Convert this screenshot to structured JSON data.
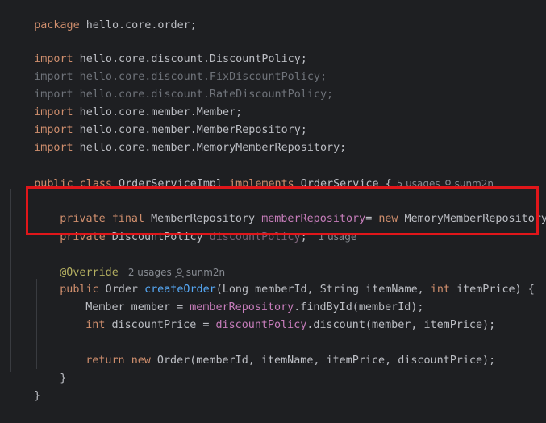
{
  "editor": {
    "language": "java",
    "colors": {
      "background": "#1e1f22",
      "keyword": "#cf8e6d",
      "text": "#bcbec4",
      "field": "#c77dbb",
      "method": "#56a8f5",
      "annotation": "#b3ae60",
      "unused": "#6f737a",
      "highlight_box": "#e0161a"
    },
    "package_line": {
      "kw": "package",
      "name": " hello.core.order;"
    },
    "imports": [
      {
        "kw": "import",
        "path": " hello.core.discount.DiscountPolicy;",
        "unused": false
      },
      {
        "kw": "import",
        "path": " hello.core.discount.FixDiscountPolicy;",
        "unused": true
      },
      {
        "kw": "import",
        "path": " hello.core.discount.RateDiscountPolicy;",
        "unused": true
      },
      {
        "kw": "import",
        "path": " hello.core.member.Member;",
        "unused": false
      },
      {
        "kw": "import",
        "path": " hello.core.member.MemberRepository;",
        "unused": false
      },
      {
        "kw": "import",
        "path": " hello.core.member.MemoryMemberRepository;",
        "unused": false
      }
    ],
    "class_decl": {
      "kw1": "public class",
      "name": " OrderServiceImpl ",
      "kw2": "implements",
      "iface": " OrderService {",
      "usages": "5 usages",
      "author": "sunm2n"
    },
    "field1": {
      "mods": "private final",
      "type": " MemberRepository ",
      "name": "memberRepository",
      "eq": "= ",
      "kw_new": "new",
      "init": " MemoryMemberRepository();"
    },
    "field2": {
      "mods": "private",
      "type": " DiscountPolicy ",
      "name": "discountPolicy",
      "semi": ";",
      "usages": "1 usage"
    },
    "override": {
      "ann": "@Override",
      "usages": "2 usages",
      "author": "sunm2n"
    },
    "method_sig": {
      "kw": "public",
      "ret": " Order ",
      "name": "createOrder",
      "p1": "(Long memberId, String itemName, ",
      "kw_int": "int",
      "p2": " itemPrice) {"
    },
    "stmt1": {
      "pre": "Member member = ",
      "field": "memberRepository",
      "post": ".findById(memberId);"
    },
    "stmt2": {
      "kw": "int",
      "pre": " discountPrice = ",
      "field": "discountPolicy",
      "post": ".discount(member, itemPrice);"
    },
    "stmt3": {
      "kw1": "return",
      "kw2": "new",
      "post": " Order(memberId, itemName, itemPrice, discountPrice);"
    },
    "close_method": "}",
    "close_class": "}"
  }
}
